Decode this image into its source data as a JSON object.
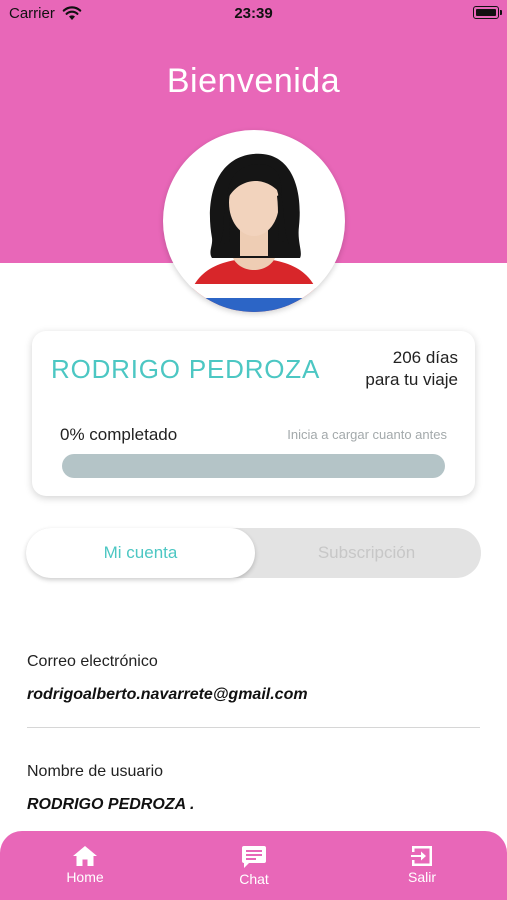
{
  "status_bar": {
    "carrier": "Carrier",
    "time": "23:39"
  },
  "header": {
    "title": "Bienvenida",
    "avatar_icon": "woman-avatar-icon"
  },
  "profile_card": {
    "name": "RODRIGO PEDROZA",
    "days_line1": "206 días",
    "days_line2": "para tu viaje",
    "progress_text": "0% completado",
    "progress_hint": "Inicia a cargar cuanto antes",
    "progress_value": 0
  },
  "segmented": {
    "account_label": "Mi cuenta",
    "subscription_label": "Subscripción",
    "selected": "account"
  },
  "fields": {
    "email_label": "Correo electrónico",
    "email_value": "rodrigoalberto.navarrete@gmail.com",
    "username_label": "Nombre de usuario",
    "username_value": "RODRIGO PEDROZA ."
  },
  "tabbar": {
    "items": [
      {
        "label": "Home",
        "icon": "home-icon"
      },
      {
        "label": "Chat",
        "icon": "chat-icon"
      },
      {
        "label": "Salir",
        "icon": "exit-icon"
      }
    ]
  },
  "colors": {
    "brand_pink": "#e867b8",
    "accent_teal": "#4cc7c3",
    "progress_track": "#b4c4c7"
  }
}
